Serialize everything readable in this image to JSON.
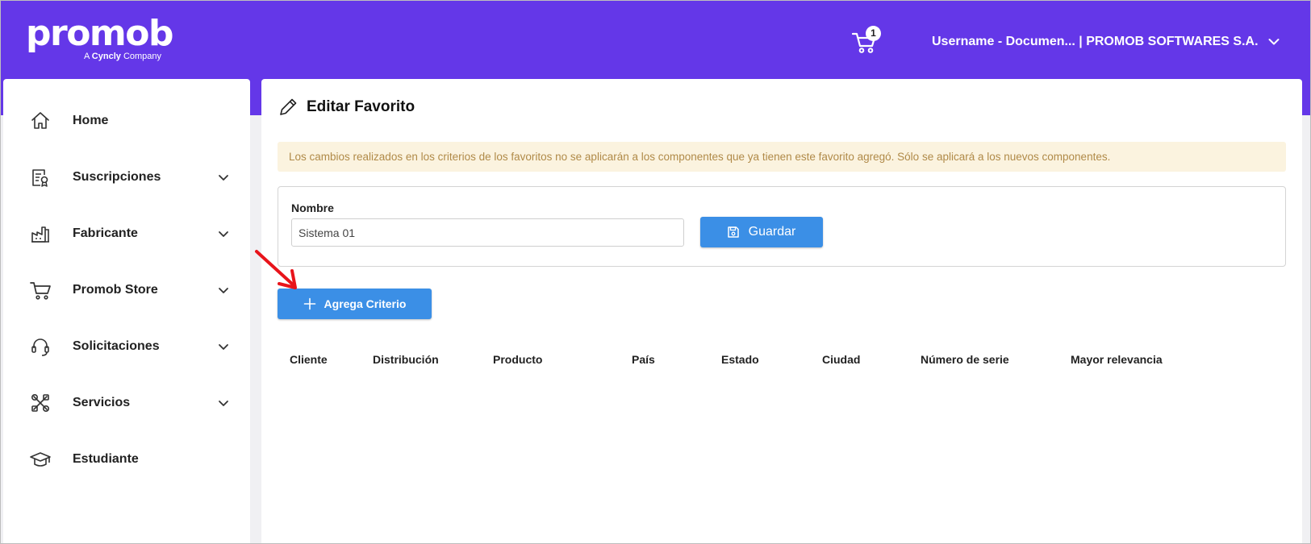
{
  "header": {
    "brand_name": "promob",
    "brand_sub_prefix": "A",
    "brand_sub_strong": "Cyncly",
    "brand_sub_suffix": "Company",
    "cart_count": "1",
    "user_label": "Username - Documen... | PROMOB SOFTWARES S.A."
  },
  "sidebar": {
    "items": [
      {
        "label": "Home",
        "icon": "home-icon",
        "expandable": false
      },
      {
        "label": "Suscripciones",
        "icon": "certificate-icon",
        "expandable": true
      },
      {
        "label": "Fabricante",
        "icon": "factory-icon",
        "expandable": true
      },
      {
        "label": "Promob Store",
        "icon": "cart-icon",
        "expandable": true
      },
      {
        "label": "Solicitaciones",
        "icon": "headset-icon",
        "expandable": true
      },
      {
        "label": "Servicios",
        "icon": "tools-icon",
        "expandable": true
      },
      {
        "label": "Estudiante",
        "icon": "graduation-cap-icon",
        "expandable": false
      }
    ]
  },
  "main": {
    "title": "Editar Favorito",
    "alert": "Los cambios realizados en los criterios de los favoritos no se aplicarán a los componentes que ya tienen este favorito agregó. Sólo se aplicará a los nuevos componentes.",
    "form": {
      "name_label": "Nombre",
      "name_value": "Sistema 01",
      "save_label": "Guardar"
    },
    "add_criterion_label": "Agrega Criterio",
    "table_headers": [
      "Cliente",
      "Distribución",
      "Producto",
      "País",
      "Estado",
      "Ciudad",
      "Número de serie",
      "Mayor relevancia"
    ]
  },
  "colors": {
    "header_bg": "#6437e8",
    "primary_button": "#3b8fe6",
    "alert_bg": "#fbf3df",
    "alert_text": "#b08a48",
    "annotation_arrow": "#e8141b"
  }
}
